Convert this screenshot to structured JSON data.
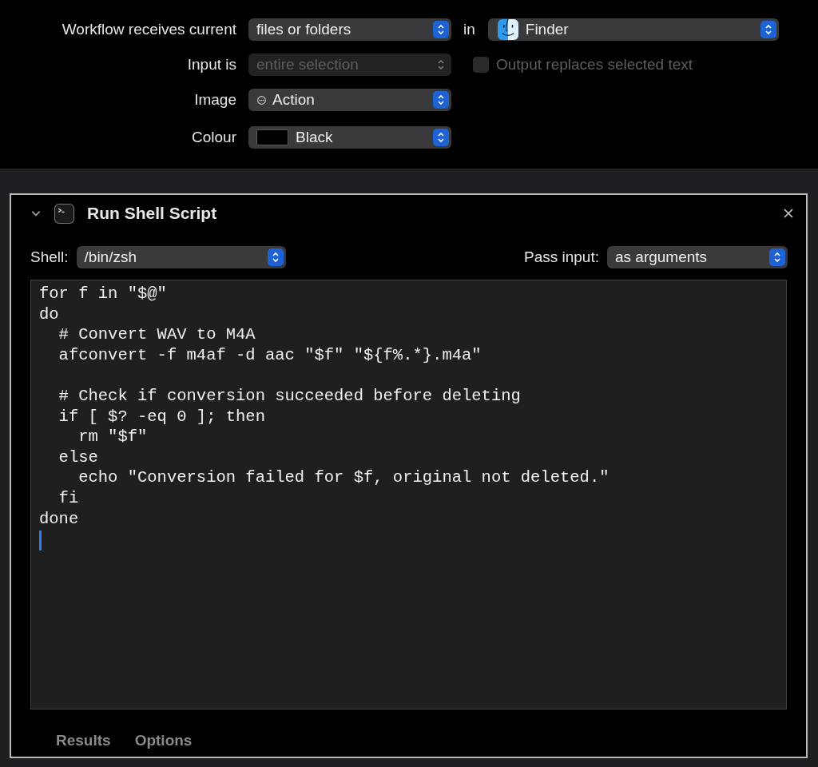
{
  "workflow": {
    "rows": [
      {
        "label": "Workflow receives current",
        "kind": "receives",
        "popup": {
          "value": "files or folders",
          "disabled": false
        },
        "in_label": "in",
        "app_popup": {
          "value": "Finder",
          "disabled": false
        }
      },
      {
        "label": "Input is",
        "kind": "input",
        "popup": {
          "value": "entire selection",
          "disabled": true
        },
        "checkbox": {
          "label": "Output replaces selected text",
          "checked": false,
          "disabled": true
        }
      },
      {
        "label": "Image",
        "kind": "image",
        "popup": {
          "value": "Action",
          "disabled": false
        }
      },
      {
        "label": "Colour",
        "kind": "colour",
        "popup": {
          "value": "Black",
          "disabled": false,
          "color": "#000000"
        }
      }
    ]
  },
  "action": {
    "title": "Run Shell Script",
    "expanded": true,
    "shell": {
      "label": "Shell:",
      "value": "/bin/zsh"
    },
    "pass_input": {
      "label": "Pass input:",
      "value": "as arguments"
    },
    "code": "for f in \"$@\"\ndo\n  # Convert WAV to M4A\n  afconvert -f m4af -d aac \"$f\" \"${f%.*}.m4a\"\n\n  # Check if conversion succeeded before deleting\n  if [ $? -eq 0 ]; then\n    rm \"$f\"\n  else\n    echo \"Conversion failed for $f, original not deleted.\"\n  fi\ndone",
    "tabs": [
      {
        "label": "Results",
        "selected": false
      },
      {
        "label": "Options",
        "selected": false
      }
    ]
  }
}
